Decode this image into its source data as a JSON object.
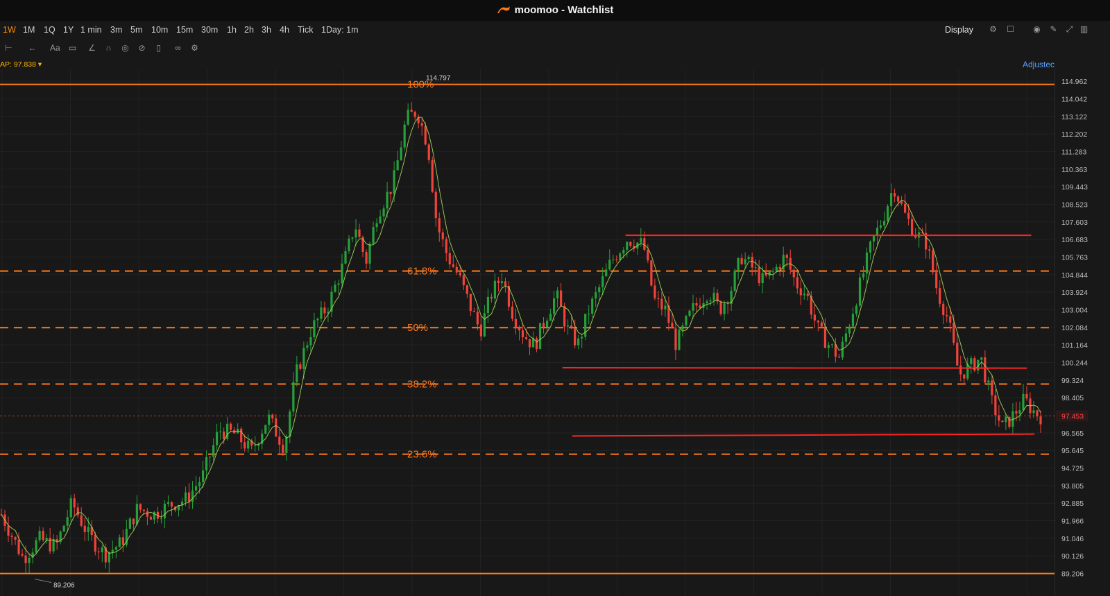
{
  "window": {
    "title": "moomoo - Watchlist"
  },
  "toolbar": {
    "timeframes": [
      "1W",
      "1M",
      "1Q",
      "1Y",
      "1 min",
      "3m",
      "5m",
      "10m",
      "15m",
      "30m",
      "1h",
      "2h",
      "3h",
      "4h",
      "Tick",
      "1Day: 1m"
    ],
    "active_timeframe": "1W",
    "display_label": "Display"
  },
  "indicator": {
    "label": "AP:",
    "value": "97.838"
  },
  "adjust_label": "Adjustec",
  "colors": {
    "up": "#26a13a",
    "down": "#f0433a",
    "fib": "#ff7a1a",
    "level": "#ff2424",
    "background": "#181818"
  },
  "chart_data": {
    "type": "candlestick",
    "y_range": [
      88.9,
      115.4
    ],
    "y_ticks": [
      "114.962",
      "114.042",
      "113.122",
      "112.202",
      "111.283",
      "110.363",
      "109.443",
      "108.523",
      "107.603",
      "106.683",
      "105.763",
      "104.844",
      "103.924",
      "103.004",
      "102.084",
      "101.164",
      "100.244",
      "99.324",
      "98.405",
      "97.453",
      "96.565",
      "95.645",
      "94.725",
      "93.805",
      "92.885",
      "91.966",
      "91.046",
      "90.126",
      "89.206"
    ],
    "current_price": 97.453,
    "high_label": "114.797",
    "low_label": "89.206",
    "fib_levels": [
      {
        "label": "100%",
        "price": 114.797,
        "style": "solid"
      },
      {
        "label": "61.8%",
        "price": 105.03,
        "style": "dashed"
      },
      {
        "label": "50%",
        "price": 102.07,
        "style": "dashed"
      },
      {
        "label": "38.2%",
        "price": 99.12,
        "style": "dashed"
      },
      {
        "label": "23.6%",
        "price": 95.45,
        "style": "dashed"
      },
      {
        "label": "",
        "price": 89.206,
        "style": "solid"
      }
    ],
    "support_resistance": [
      {
        "price_start": 106.9,
        "price_end": 106.9,
        "x_start": 0.575,
        "x_end": 0.948
      },
      {
        "price_start": 99.97,
        "price_end": 99.95,
        "x_start": 0.517,
        "x_end": 0.944
      },
      {
        "price_start": 96.4,
        "price_end": 96.5,
        "x_start": 0.526,
        "x_end": 0.951
      }
    ],
    "price_path": [
      [
        0.0,
        92.3
      ],
      [
        0.02,
        90.0
      ],
      [
        0.035,
        91.0
      ],
      [
        0.05,
        90.6
      ],
      [
        0.065,
        92.9
      ],
      [
        0.08,
        91.2
      ],
      [
        0.095,
        90.2
      ],
      [
        0.11,
        90.8
      ],
      [
        0.125,
        92.6
      ],
      [
        0.14,
        92.3
      ],
      [
        0.155,
        92.8
      ],
      [
        0.17,
        93.1
      ],
      [
        0.185,
        94.3
      ],
      [
        0.2,
        96.7
      ],
      [
        0.215,
        96.5
      ],
      [
        0.23,
        95.6
      ],
      [
        0.245,
        97.4
      ],
      [
        0.26,
        95.8
      ],
      [
        0.27,
        99.5
      ],
      [
        0.285,
        102.0
      ],
      [
        0.3,
        103.2
      ],
      [
        0.315,
        105.5
      ],
      [
        0.325,
        107.5
      ],
      [
        0.335,
        105.5
      ],
      [
        0.345,
        108.0
      ],
      [
        0.36,
        109.6
      ],
      [
        0.372,
        113.0
      ],
      [
        0.382,
        113.4
      ],
      [
        0.392,
        111.6
      ],
      [
        0.4,
        107.5
      ],
      [
        0.41,
        105.8
      ],
      [
        0.42,
        104.8
      ],
      [
        0.43,
        103.3
      ],
      [
        0.44,
        101.9
      ],
      [
        0.45,
        103.8
      ],
      [
        0.46,
        104.8
      ],
      [
        0.47,
        102.8
      ],
      [
        0.48,
        101.7
      ],
      [
        0.49,
        101.1
      ],
      [
        0.5,
        102.6
      ],
      [
        0.51,
        103.8
      ],
      [
        0.52,
        102.0
      ],
      [
        0.53,
        101.2
      ],
      [
        0.54,
        103.0
      ],
      [
        0.55,
        104.2
      ],
      [
        0.56,
        105.5
      ],
      [
        0.575,
        106.7
      ],
      [
        0.59,
        106.4
      ],
      [
        0.6,
        103.5
      ],
      [
        0.61,
        103.0
      ],
      [
        0.62,
        101.2
      ],
      [
        0.635,
        103.0
      ],
      [
        0.65,
        104.0
      ],
      [
        0.66,
        103.0
      ],
      [
        0.67,
        104.0
      ],
      [
        0.68,
        105.8
      ],
      [
        0.69,
        105.2
      ],
      [
        0.7,
        104.5
      ],
      [
        0.71,
        105.0
      ],
      [
        0.72,
        105.8
      ],
      [
        0.73,
        104.4
      ],
      [
        0.74,
        103.8
      ],
      [
        0.75,
        102.0
      ],
      [
        0.76,
        101.2
      ],
      [
        0.77,
        100.5
      ],
      [
        0.78,
        102.5
      ],
      [
        0.79,
        104.5
      ],
      [
        0.8,
        106.5
      ],
      [
        0.81,
        107.8
      ],
      [
        0.82,
        109.5
      ],
      [
        0.83,
        108.0
      ],
      [
        0.84,
        107.0
      ],
      [
        0.85,
        106.5
      ],
      [
        0.86,
        104.0
      ],
      [
        0.87,
        102.5
      ],
      [
        0.88,
        99.6
      ],
      [
        0.89,
        100.0
      ],
      [
        0.9,
        100.5
      ],
      [
        0.91,
        98.2
      ],
      [
        0.92,
        96.8
      ],
      [
        0.93,
        97.5
      ],
      [
        0.94,
        98.3
      ],
      [
        0.95,
        97.6
      ],
      [
        0.955,
        97.45
      ]
    ]
  }
}
